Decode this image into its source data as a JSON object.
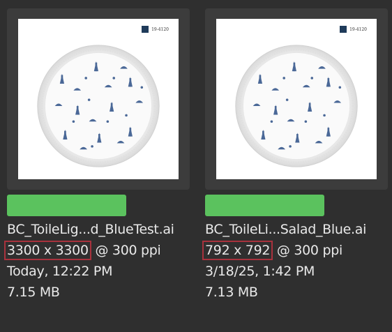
{
  "files": [
    {
      "swatch_code": "19-4120",
      "name": "BC_ToileLig...d_BlueTest.ai",
      "dimensions": "3300 x 3300",
      "resolution": "@ 300 ppi",
      "date": "Today, 12:22 PM",
      "size": "7.15 MB"
    },
    {
      "swatch_code": "19-4120",
      "name": "BC_ToileLi...Salad_Blue.ai",
      "dimensions": "792 x 792",
      "resolution": "@ 300 ppi",
      "date": "3/18/25, 1:42 PM",
      "size": "7.13 MB"
    }
  ],
  "colors": {
    "background": "#2f2f2f",
    "card": "#3c3c3c",
    "label_green": "#5bc25e",
    "highlight_box": "#a8323d",
    "pattern_blue": "#2c4f86"
  }
}
